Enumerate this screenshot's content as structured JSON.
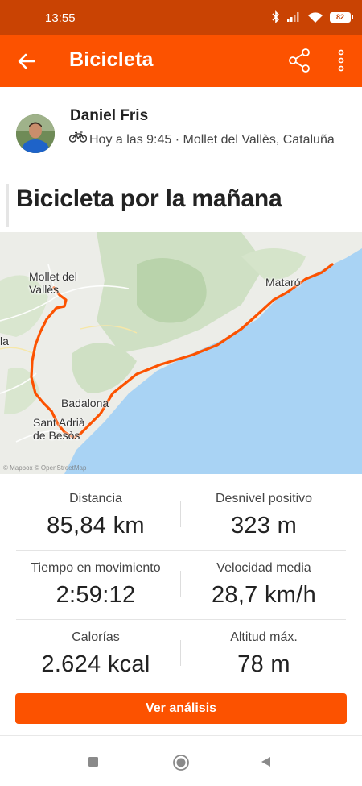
{
  "status": {
    "time": "13:55",
    "battery": "82",
    "icons": [
      "bluetooth-icon",
      "signal-icon",
      "wifi-icon",
      "battery-icon"
    ]
  },
  "appbar": {
    "title": "Bicicleta",
    "back_icon": "arrow-left-icon",
    "share_icon": "share-icon",
    "more_icon": "more-vertical-icon",
    "color": "#fc5200"
  },
  "athlete": {
    "name": "Daniel Fris",
    "meta": "Hoy a las 9:45 · Mollet del Vallès, Cataluña",
    "activity_icon": "bike-icon"
  },
  "activity": {
    "title": "Bicicleta por la mañana"
  },
  "map": {
    "labels": {
      "mollet": "Mollet del Vallès",
      "mataro": "Mataró",
      "badalona": "Badalona",
      "sant_adria": "Sant Adrià de Besòs",
      "edge": "la"
    },
    "attribution": "© Mapbox © OpenStreetMap",
    "route_color": "#fc5200",
    "sea_color": "#a9d3f4"
  },
  "stats": [
    {
      "label": "Distancia",
      "value": "85,84 km"
    },
    {
      "label": "Desnivel positivo",
      "value": "323 m"
    },
    {
      "label": "Tiempo en movimiento",
      "value": "2:59:12"
    },
    {
      "label": "Velocidad media",
      "value": "28,7 km/h"
    },
    {
      "label": "Calorías",
      "value": "2.624 kcal"
    },
    {
      "label": "Altitud máx.",
      "value": "78 m"
    }
  ],
  "cta": {
    "label": "Ver análisis"
  },
  "navbar": {
    "icons": [
      "recents-square-icon",
      "home-circle-icon",
      "back-triangle-icon"
    ]
  }
}
